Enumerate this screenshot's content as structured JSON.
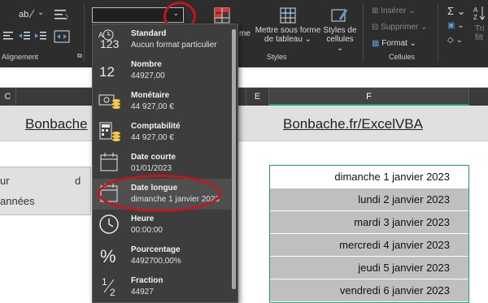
{
  "ribbon": {
    "groups": {
      "alignment": "Alignement",
      "styles": "Styles",
      "cells": "Cellules"
    },
    "styles_buttons": {
      "conditional_partial": "me",
      "format_as_table": "Mettre sous forme de tableau",
      "cell_styles": "Styles de cellules"
    },
    "cells_buttons": {
      "insert": "Insérer",
      "delete": "Supprimer",
      "format": "Format"
    },
    "editing_partial": {
      "sigma": "Σ",
      "sort": "Tri",
      "filter": "filt"
    },
    "number_format_value": ""
  },
  "columns": {
    "c": "C",
    "e": "E",
    "f": "F"
  },
  "sheet": {
    "title_left": "Bonbache",
    "title_right": "Bonbache.fr/ExcelVBA",
    "left_text_1": "ur",
    "left_text_2": "années",
    "left_text_3": "d",
    "dates": [
      "dimanche 1 janvier 2023",
      "lundi 2 janvier 2023",
      "mardi 3 janvier 2023",
      "mercredi 4 janvier 2023",
      "jeudi 5 janvier 2023",
      "vendredi 6 janvier 2023"
    ]
  },
  "format_menu": [
    {
      "name": "Standard",
      "example": "Aucun format particulier",
      "icon": "standard-123-icon"
    },
    {
      "name": "Nombre",
      "example": "44927,00",
      "icon": "number-12-icon"
    },
    {
      "name": "Monétaire",
      "example": "44 927,00 €",
      "icon": "currency-icon"
    },
    {
      "name": "Comptabilité",
      "example": "44 927,00 €",
      "icon": "accounting-icon"
    },
    {
      "name": "Date courte",
      "example": "01/01/2023",
      "icon": "calendar-short-icon"
    },
    {
      "name": "Date longue",
      "example": "dimanche 1 janvier 2023",
      "icon": "calendar-long-icon"
    },
    {
      "name": "Heure",
      "example": "00:00:00",
      "icon": "clock-icon"
    },
    {
      "name": "Pourcentage",
      "example": "4492700,00%",
      "icon": "percent-icon"
    },
    {
      "name": "Fraction",
      "example": "44927",
      "icon": "fraction-icon"
    }
  ],
  "colors": {
    "annotation_red": "#c4161c",
    "selection_green": "#21a366",
    "ribbon_bg": "#2d2d2d"
  }
}
